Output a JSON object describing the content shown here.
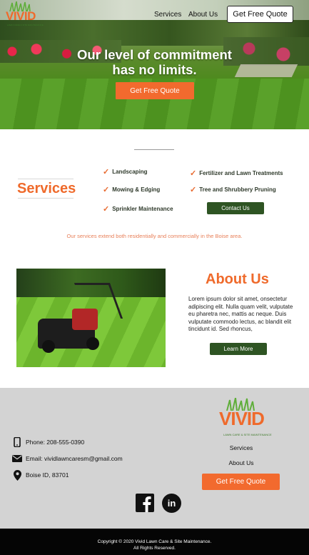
{
  "brand": {
    "name": "VIVID",
    "tagline": "LAWN CARE & SITE MAINTENANCE"
  },
  "nav": {
    "services": "Services",
    "about": "About Us",
    "quote": "Get Free Quote"
  },
  "hero": {
    "title_line1": "Our level of commitment",
    "title_line2": "has no limits.",
    "cta": "Get Free Quote"
  },
  "services": {
    "title": "Services",
    "items": [
      "Landscaping",
      "Fertilizer and Lawn Treatments",
      "Mowing & Edging",
      "Tree and Shrubbery Pruning",
      "Sprinkler Maintenance"
    ],
    "contact_button": "Contact Us",
    "note": "Our services extend both residentially and commercially in the Boise area."
  },
  "about": {
    "title": "About Us",
    "text": "Lorem ipsum dolor sit amet, onsectetur adipiscing elit. Nulla quam velit, vulputate eu pharetra nec, mattis ac neque. Duis vulputate commodo lectus, ac blandit elit tincidunt id. Sed rhoncus,",
    "button": "Learn More"
  },
  "footer": {
    "phone": "Phone: 208-555-0390",
    "email": "Email: vividlawncaresm@gmail.com",
    "location": "Boise ID, 83701",
    "links": [
      "Services",
      "About Us"
    ],
    "quote": "Get Free Quote",
    "copyright_line1": "Copyright © 2020 Vivid Lawn Care & Site Maintenance.",
    "copyright_line2": "All Rights Reserved."
  },
  "colors": {
    "accent": "#ef6a2b",
    "dark_green": "#2e5423",
    "footer_bg": "#d3d3d3"
  }
}
